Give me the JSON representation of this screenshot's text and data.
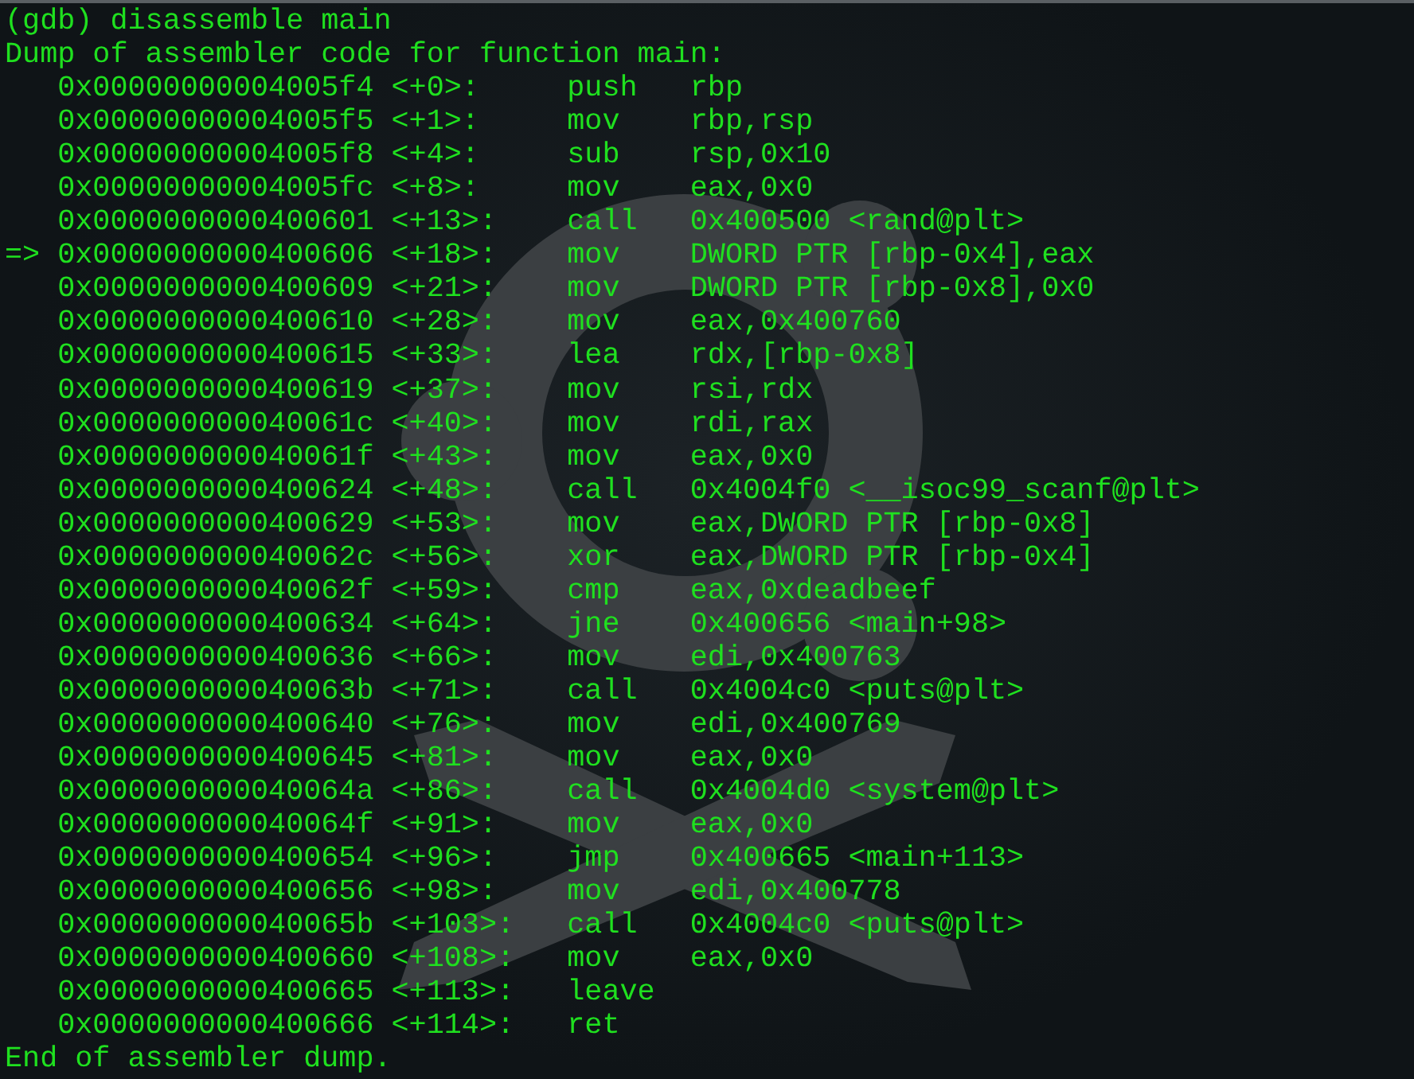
{
  "terminal": {
    "prompt": "(gdb) disassemble main",
    "header": "Dump of assembler code for function main:",
    "instructions": [
      {
        "address": "0x00000000004005f4",
        "offset": "<+0>:",
        "mnemonic": "push",
        "operands": "rbp"
      },
      {
        "address": "0x00000000004005f5",
        "offset": "<+1>:",
        "mnemonic": "mov",
        "operands": "rbp,rsp"
      },
      {
        "address": "0x00000000004005f8",
        "offset": "<+4>:",
        "mnemonic": "sub",
        "operands": "rsp,0x10"
      },
      {
        "address": "0x00000000004005fc",
        "offset": "<+8>:",
        "mnemonic": "mov",
        "operands": "eax,0x0"
      },
      {
        "address": "0x0000000000400601",
        "offset": "<+13>:",
        "mnemonic": "call",
        "operands": "0x400500 <rand@plt>"
      },
      {
        "marker": "=>",
        "address": "0x0000000000400606",
        "offset": "<+18>:",
        "mnemonic": "mov",
        "operands": "DWORD PTR [rbp-0x4],eax"
      },
      {
        "address": "0x0000000000400609",
        "offset": "<+21>:",
        "mnemonic": "mov",
        "operands": "DWORD PTR [rbp-0x8],0x0"
      },
      {
        "address": "0x0000000000400610",
        "offset": "<+28>:",
        "mnemonic": "mov",
        "operands": "eax,0x400760"
      },
      {
        "address": "0x0000000000400615",
        "offset": "<+33>:",
        "mnemonic": "lea",
        "operands": "rdx,[rbp-0x8]"
      },
      {
        "address": "0x0000000000400619",
        "offset": "<+37>:",
        "mnemonic": "mov",
        "operands": "rsi,rdx"
      },
      {
        "address": "0x000000000040061c",
        "offset": "<+40>:",
        "mnemonic": "mov",
        "operands": "rdi,rax"
      },
      {
        "address": "0x000000000040061f",
        "offset": "<+43>:",
        "mnemonic": "mov",
        "operands": "eax,0x0"
      },
      {
        "address": "0x0000000000400624",
        "offset": "<+48>:",
        "mnemonic": "call",
        "operands": "0x4004f0 <__isoc99_scanf@plt>"
      },
      {
        "address": "0x0000000000400629",
        "offset": "<+53>:",
        "mnemonic": "mov",
        "operands": "eax,DWORD PTR [rbp-0x8]"
      },
      {
        "address": "0x000000000040062c",
        "offset": "<+56>:",
        "mnemonic": "xor",
        "operands": "eax,DWORD PTR [rbp-0x4]"
      },
      {
        "address": "0x000000000040062f",
        "offset": "<+59>:",
        "mnemonic": "cmp",
        "operands": "eax,0xdeadbeef"
      },
      {
        "address": "0x0000000000400634",
        "offset": "<+64>:",
        "mnemonic": "jne",
        "operands": "0x400656 <main+98>"
      },
      {
        "address": "0x0000000000400636",
        "offset": "<+66>:",
        "mnemonic": "mov",
        "operands": "edi,0x400763"
      },
      {
        "address": "0x000000000040063b",
        "offset": "<+71>:",
        "mnemonic": "call",
        "operands": "0x4004c0 <puts@plt>"
      },
      {
        "address": "0x0000000000400640",
        "offset": "<+76>:",
        "mnemonic": "mov",
        "operands": "edi,0x400769"
      },
      {
        "address": "0x0000000000400645",
        "offset": "<+81>:",
        "mnemonic": "mov",
        "operands": "eax,0x0"
      },
      {
        "address": "0x000000000040064a",
        "offset": "<+86>:",
        "mnemonic": "call",
        "operands": "0x4004d0 <system@plt>"
      },
      {
        "address": "0x000000000040064f",
        "offset": "<+91>:",
        "mnemonic": "mov",
        "operands": "eax,0x0"
      },
      {
        "address": "0x0000000000400654",
        "offset": "<+96>:",
        "mnemonic": "jmp",
        "operands": "0x400665 <main+113>"
      },
      {
        "address": "0x0000000000400656",
        "offset": "<+98>:",
        "mnemonic": "mov",
        "operands": "edi,0x400778"
      },
      {
        "address": "0x000000000040065b",
        "offset": "<+103>:",
        "mnemonic": "call",
        "operands": "0x4004c0 <puts@plt>"
      },
      {
        "address": "0x0000000000400660",
        "offset": "<+108>:",
        "mnemonic": "mov",
        "operands": "eax,0x0"
      },
      {
        "address": "0x0000000000400665",
        "offset": "<+113>:",
        "mnemonic": "leave"
      },
      {
        "address": "0x0000000000400666",
        "offset": "<+114>:",
        "mnemonic": "ret"
      }
    ],
    "footer": "End of assembler dump."
  }
}
